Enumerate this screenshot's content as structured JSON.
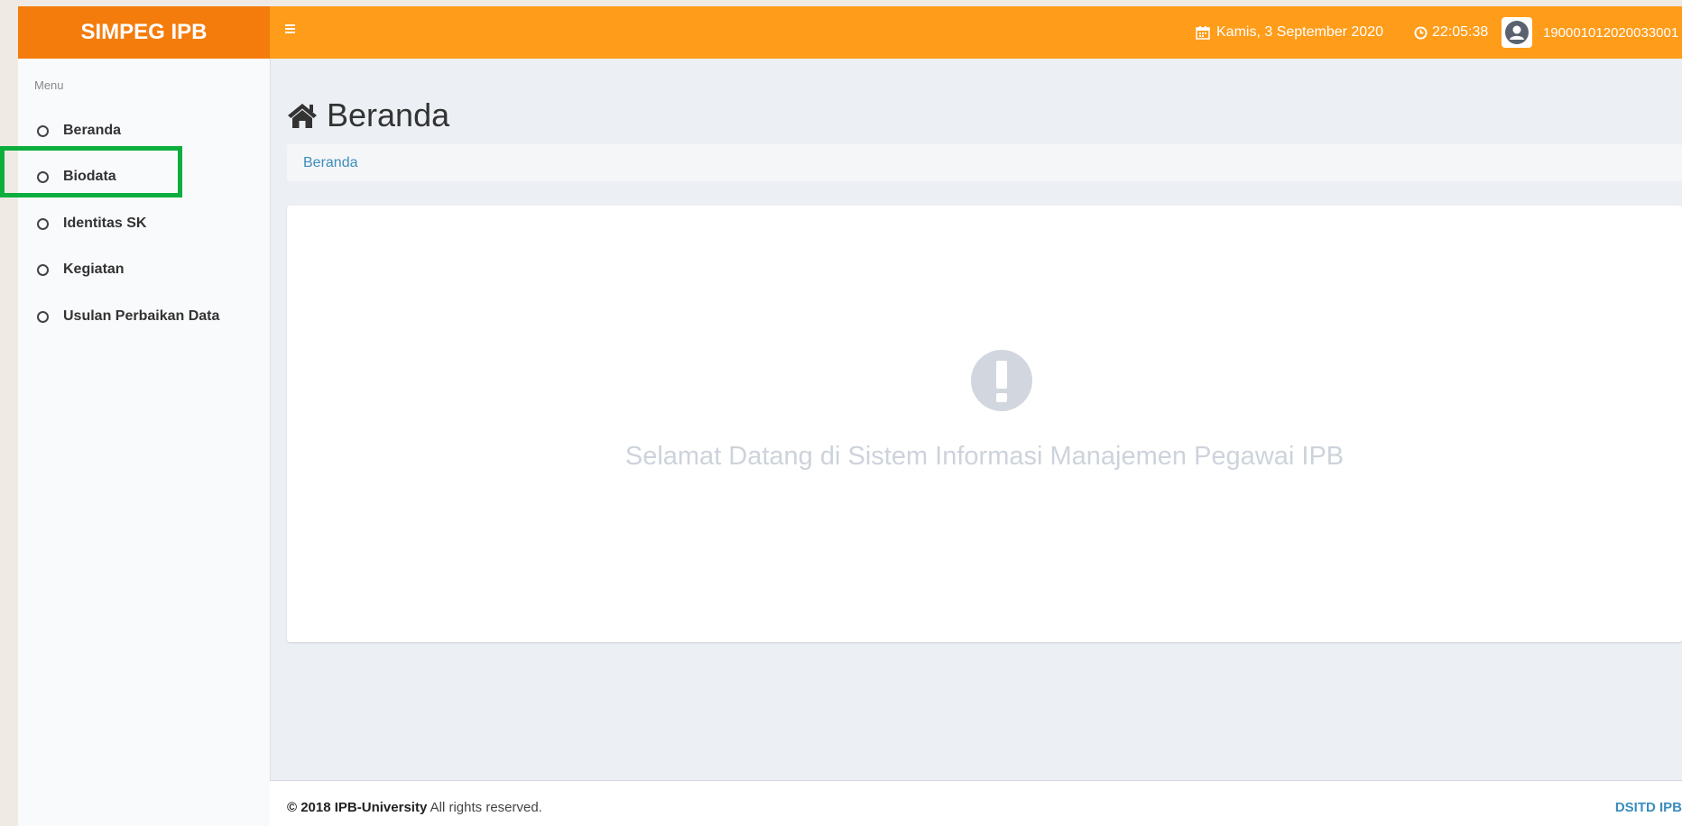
{
  "header": {
    "brand": "SIMPEG IPB",
    "menu_toggle_icon": "hamburger-icon",
    "date": "Kamis, 3 September 2020",
    "date_icon": "calendar-icon",
    "time": "22:05:38",
    "time_icon": "clock-icon",
    "user_id": "190001012020033001",
    "user_icon": "user-avatar-icon",
    "color_brand": "#f47c0c",
    "color_bar": "#ff9c1a"
  },
  "sidebar": {
    "header": "Menu",
    "items": [
      {
        "label": "Beranda"
      },
      {
        "label": "Biodata"
      },
      {
        "label": "Identitas SK"
      },
      {
        "label": "Kegiatan"
      },
      {
        "label": "Usulan Perbaikan Data"
      }
    ]
  },
  "main": {
    "title": "Beranda",
    "title_icon": "home-icon",
    "breadcrumb": "Beranda",
    "alert_icon": "exclamation-circle-icon",
    "welcome": "Selamat Datang di Sistem Informasi Manajemen Pegawai IPB"
  },
  "footer": {
    "copyright": "© 2018 IPB-University",
    "rights": " All rights reserved.",
    "credit": "DSITD IPB"
  }
}
